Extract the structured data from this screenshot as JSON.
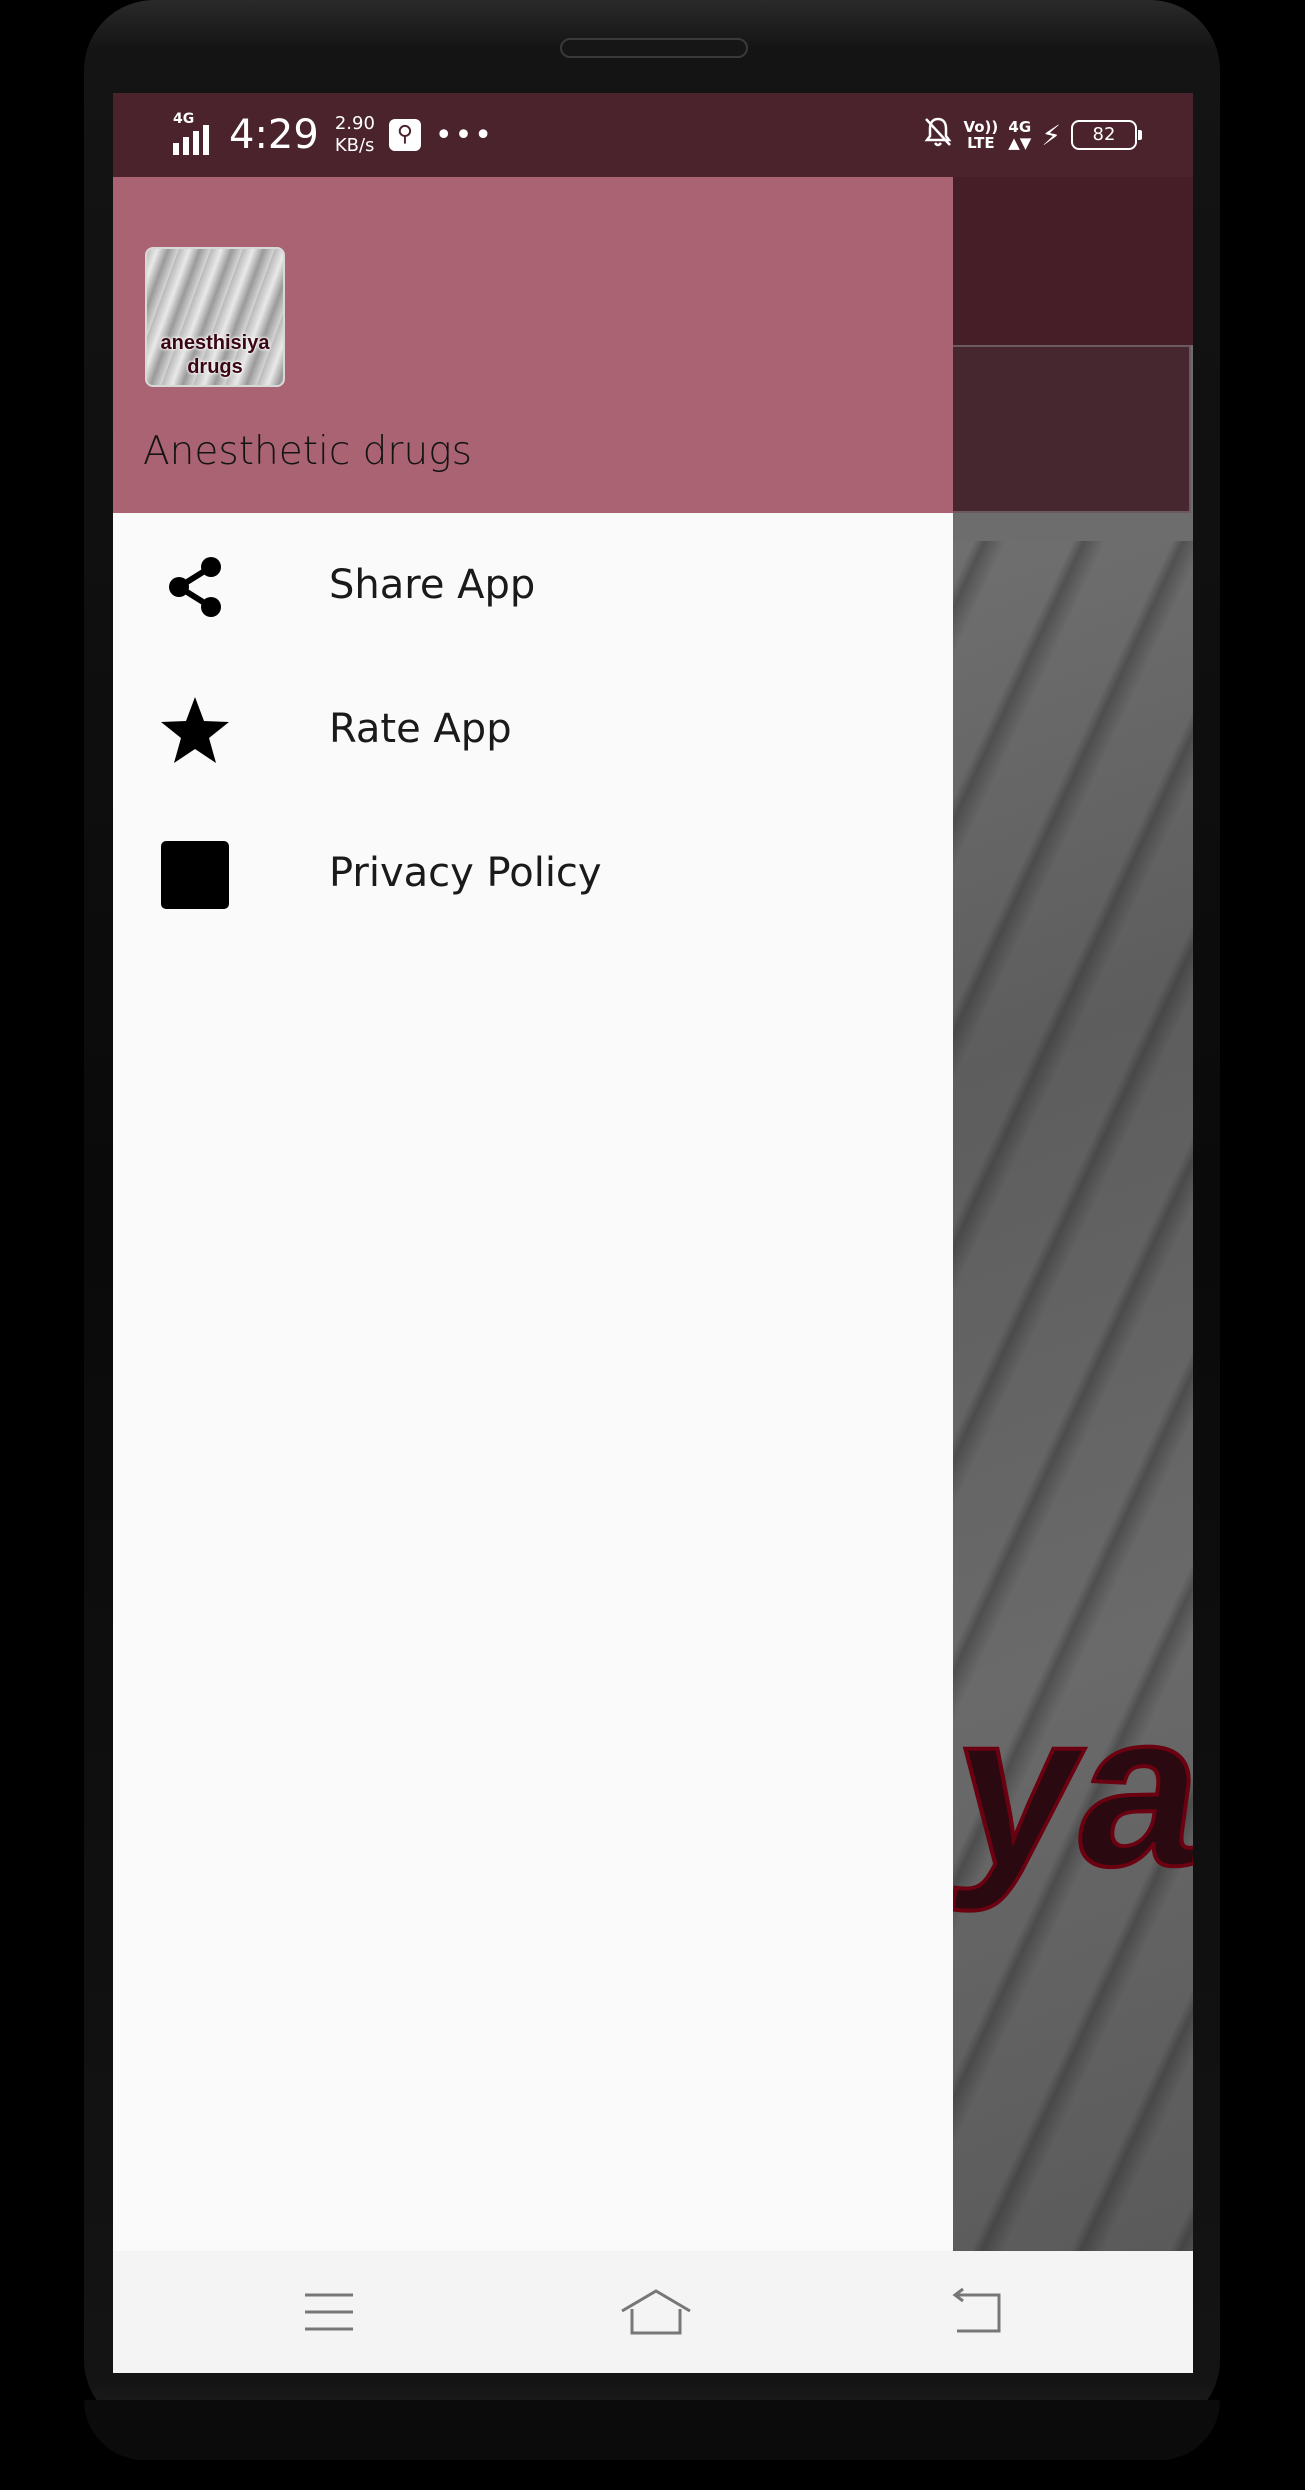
{
  "status_bar": {
    "network": "4G",
    "time": "4:29",
    "speed_value": "2.90",
    "speed_unit": "KB/s",
    "volte": "Vo))",
    "lte": "LTE",
    "network_right": "4G",
    "battery": "82"
  },
  "drawer": {
    "icon_text_line1": "anesthisiya",
    "icon_text_line2": "drugs",
    "title": "Anesthetic drugs",
    "items": [
      {
        "label": "Share App",
        "icon": "share-icon"
      },
      {
        "label": "Rate App",
        "icon": "star-icon"
      },
      {
        "label": "Privacy Policy",
        "icon": "square-icon"
      }
    ]
  },
  "background": {
    "image_text": "ya"
  },
  "nav_bar": {
    "buttons": [
      "menu-icon",
      "home-icon",
      "back-icon"
    ]
  },
  "colors": {
    "status_bar": "#4a232c",
    "drawer_header": "#aa6372",
    "drawer_bg": "#fafafa",
    "nav_bar": "#f4f4f4"
  }
}
